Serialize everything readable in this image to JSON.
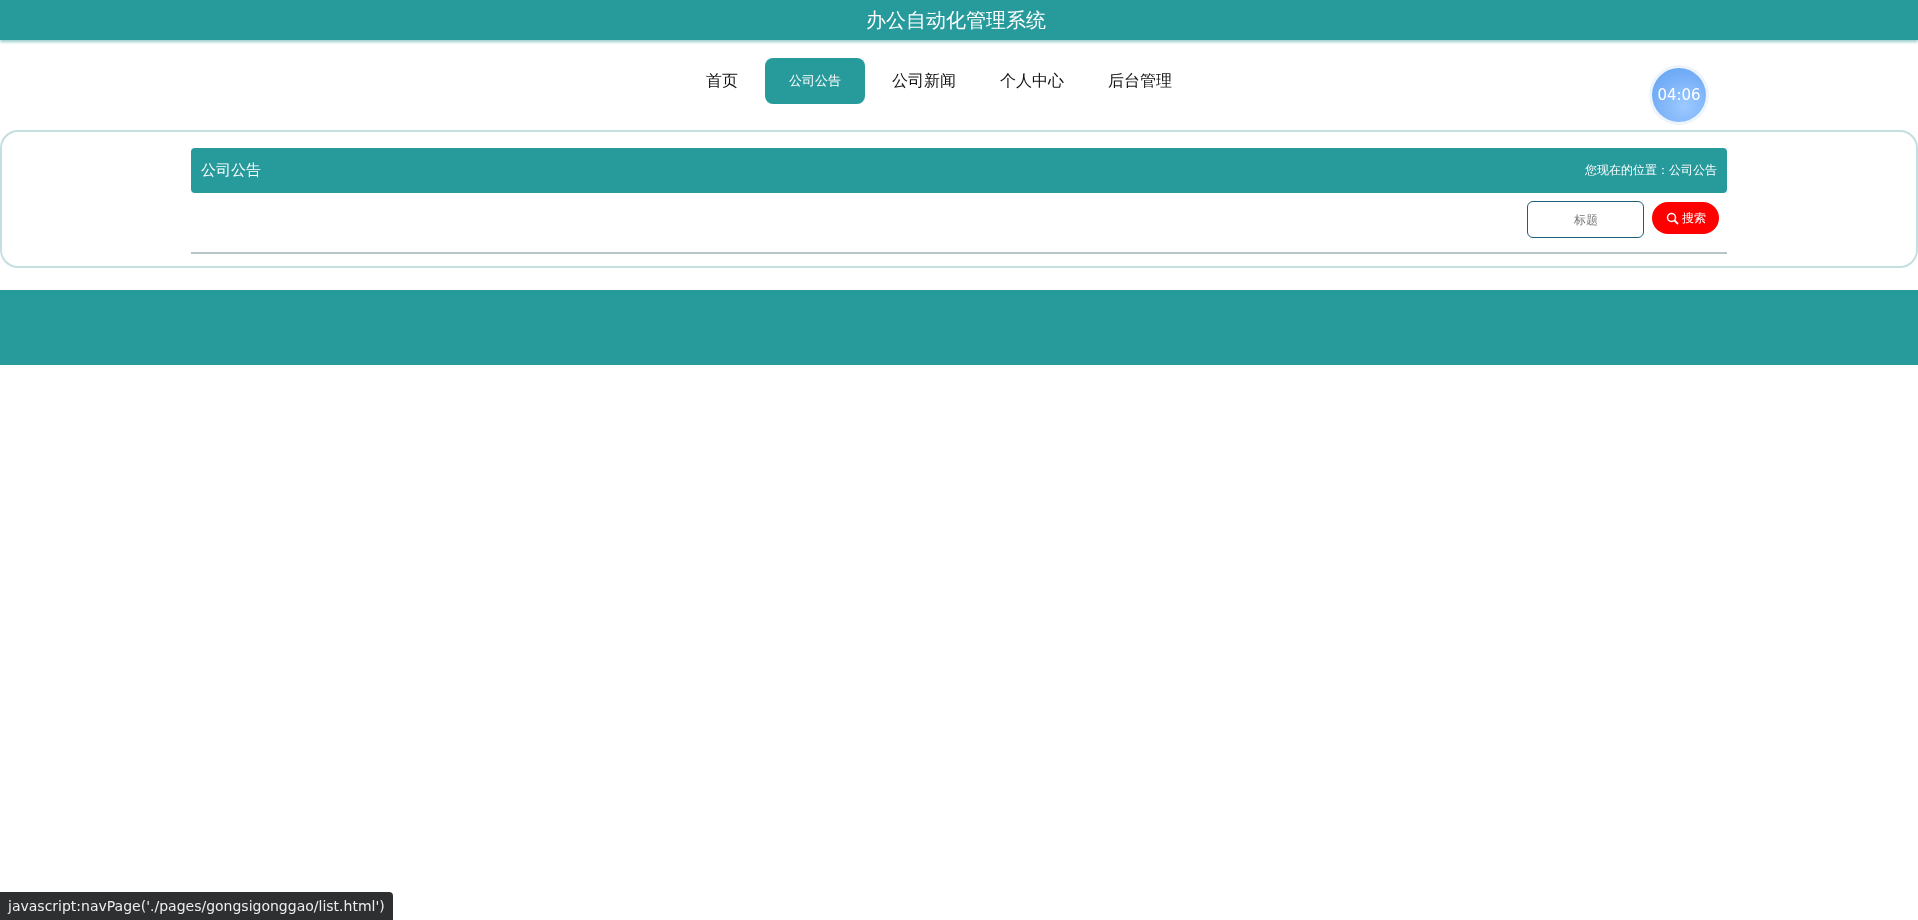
{
  "header": {
    "title": "办公自动化管理系统"
  },
  "nav": [
    {
      "label": "首页",
      "selected": false
    },
    {
      "label": "公司公告",
      "selected": true
    },
    {
      "label": "公司新闻",
      "selected": false
    },
    {
      "label": "个人中心",
      "selected": false
    },
    {
      "label": "后台管理",
      "selected": false
    }
  ],
  "clock": {
    "time": "04:06"
  },
  "panel": {
    "title": "公司公告",
    "breadcrumb": "您现在的位置：公司公告"
  },
  "search": {
    "placeholder": "标题",
    "button": "搜索"
  },
  "status_url": "javascript:navPage('./pages/gongsigonggao/list.html')"
}
